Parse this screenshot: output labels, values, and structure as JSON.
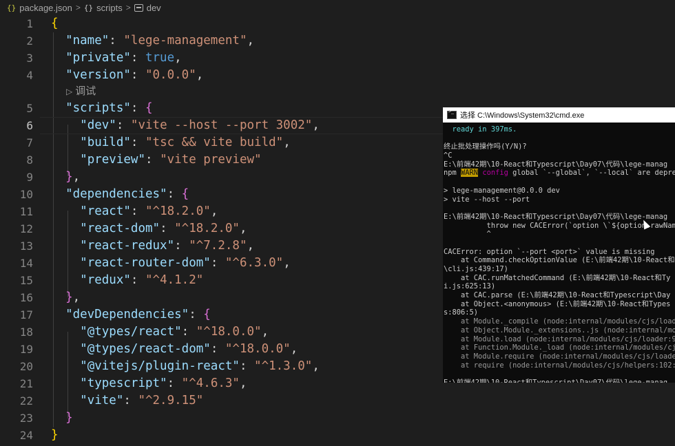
{
  "breadcrumb": {
    "file": "package.json",
    "section": "scripts",
    "key": "dev"
  },
  "codelens_label": "调试",
  "lines": [
    {
      "n": "1",
      "code": [
        [
          "b1",
          "{"
        ]
      ]
    },
    {
      "n": "2",
      "code": [
        [
          "p",
          "  "
        ],
        [
          "k",
          "\"name\""
        ],
        [
          "p",
          ": "
        ],
        [
          "s",
          "\"lege-management\""
        ],
        [
          "p",
          ","
        ]
      ]
    },
    {
      "n": "3",
      "code": [
        [
          "p",
          "  "
        ],
        [
          "k",
          "\"private\""
        ],
        [
          "p",
          ": "
        ],
        [
          "t",
          "true"
        ],
        [
          "p",
          ","
        ]
      ]
    },
    {
      "n": "4",
      "code": [
        [
          "p",
          "  "
        ],
        [
          "k",
          "\"version\""
        ],
        [
          "p",
          ": "
        ],
        [
          "s",
          "\"0.0.0\""
        ],
        [
          "p",
          ","
        ]
      ]
    },
    {
      "n": "5",
      "code": [
        [
          "p",
          "  "
        ],
        [
          "k",
          "\"scripts\""
        ],
        [
          "p",
          ": "
        ],
        [
          "b2",
          "{"
        ]
      ]
    },
    {
      "n": "6",
      "code": [
        [
          "p",
          "    "
        ],
        [
          "k",
          "\"dev\""
        ],
        [
          "p",
          ": "
        ],
        [
          "s",
          "\"vite --host --port 3002\""
        ],
        [
          "p",
          ","
        ]
      ]
    },
    {
      "n": "7",
      "code": [
        [
          "p",
          "    "
        ],
        [
          "k",
          "\"build\""
        ],
        [
          "p",
          ": "
        ],
        [
          "s",
          "\"tsc && vite build\""
        ],
        [
          "p",
          ","
        ]
      ]
    },
    {
      "n": "8",
      "code": [
        [
          "p",
          "    "
        ],
        [
          "k",
          "\"preview\""
        ],
        [
          "p",
          ": "
        ],
        [
          "s",
          "\"vite preview\""
        ]
      ]
    },
    {
      "n": "9",
      "code": [
        [
          "p",
          "  "
        ],
        [
          "b2",
          "}"
        ],
        [
          "p",
          ","
        ]
      ]
    },
    {
      "n": "10",
      "code": [
        [
          "p",
          "  "
        ],
        [
          "k",
          "\"dependencies\""
        ],
        [
          "p",
          ": "
        ],
        [
          "b2",
          "{"
        ]
      ]
    },
    {
      "n": "11",
      "code": [
        [
          "p",
          "    "
        ],
        [
          "k",
          "\"react\""
        ],
        [
          "p",
          ": "
        ],
        [
          "s",
          "\"^18.2.0\""
        ],
        [
          "p",
          ","
        ]
      ]
    },
    {
      "n": "12",
      "code": [
        [
          "p",
          "    "
        ],
        [
          "k",
          "\"react-dom\""
        ],
        [
          "p",
          ": "
        ],
        [
          "s",
          "\"^18.2.0\""
        ],
        [
          "p",
          ","
        ]
      ]
    },
    {
      "n": "13",
      "code": [
        [
          "p",
          "    "
        ],
        [
          "k",
          "\"react-redux\""
        ],
        [
          "p",
          ": "
        ],
        [
          "s",
          "\"^7.2.8\""
        ],
        [
          "p",
          ","
        ]
      ]
    },
    {
      "n": "14",
      "code": [
        [
          "p",
          "    "
        ],
        [
          "k",
          "\"react-router-dom\""
        ],
        [
          "p",
          ": "
        ],
        [
          "s",
          "\"^6.3.0\""
        ],
        [
          "p",
          ","
        ]
      ]
    },
    {
      "n": "15",
      "code": [
        [
          "p",
          "    "
        ],
        [
          "k",
          "\"redux\""
        ],
        [
          "p",
          ": "
        ],
        [
          "s",
          "\"^4.1.2\""
        ]
      ]
    },
    {
      "n": "16",
      "code": [
        [
          "p",
          "  "
        ],
        [
          "b2",
          "}"
        ],
        [
          "p",
          ","
        ]
      ]
    },
    {
      "n": "17",
      "code": [
        [
          "p",
          "  "
        ],
        [
          "k",
          "\"devDependencies\""
        ],
        [
          "p",
          ": "
        ],
        [
          "b2",
          "{"
        ]
      ]
    },
    {
      "n": "18",
      "code": [
        [
          "p",
          "    "
        ],
        [
          "k",
          "\"@types/react\""
        ],
        [
          "p",
          ": "
        ],
        [
          "s",
          "\"^18.0.0\""
        ],
        [
          "p",
          ","
        ]
      ]
    },
    {
      "n": "19",
      "code": [
        [
          "p",
          "    "
        ],
        [
          "k",
          "\"@types/react-dom\""
        ],
        [
          "p",
          ": "
        ],
        [
          "s",
          "\"^18.0.0\""
        ],
        [
          "p",
          ","
        ]
      ]
    },
    {
      "n": "20",
      "code": [
        [
          "p",
          "    "
        ],
        [
          "k",
          "\"@vitejs/plugin-react\""
        ],
        [
          "p",
          ": "
        ],
        [
          "s",
          "\"^1.3.0\""
        ],
        [
          "p",
          ","
        ]
      ]
    },
    {
      "n": "21",
      "code": [
        [
          "p",
          "    "
        ],
        [
          "k",
          "\"typescript\""
        ],
        [
          "p",
          ": "
        ],
        [
          "s",
          "\"^4.6.3\""
        ],
        [
          "p",
          ","
        ]
      ]
    },
    {
      "n": "22",
      "code": [
        [
          "p",
          "    "
        ],
        [
          "k",
          "\"vite\""
        ],
        [
          "p",
          ": "
        ],
        [
          "s",
          "\"^2.9.15\""
        ]
      ]
    },
    {
      "n": "23",
      "code": [
        [
          "p",
          "  "
        ],
        [
          "b2",
          "}"
        ]
      ]
    },
    {
      "n": "24",
      "code": [
        [
          "b1",
          "}"
        ]
      ]
    }
  ],
  "cmd": {
    "title": "选择 C:\\Windows\\System32\\cmd.exe",
    "lines": [
      {
        "c": "cyan",
        "parts": [
          [
            "",
            "  ready in 397ms."
          ]
        ]
      },
      {
        "c": "",
        "parts": [
          [
            "",
            ""
          ]
        ]
      },
      {
        "c": "",
        "parts": [
          [
            "",
            "终止批处理操作吗(Y/N)?"
          ]
        ]
      },
      {
        "c": "",
        "parts": [
          [
            "",
            "^C"
          ]
        ]
      },
      {
        "c": "",
        "parts": [
          [
            "",
            "E:\\前端42期\\10-React和Typescript\\Day07\\代码\\lege-manag"
          ]
        ]
      },
      {
        "c": "",
        "parts": [
          [
            "",
            "npm "
          ],
          [
            "warn",
            "WARN"
          ],
          [
            "mag",
            " config"
          ],
          [
            "",
            " global `--global`, `--local` are depre"
          ]
        ]
      },
      {
        "c": "",
        "parts": [
          [
            "",
            ""
          ]
        ]
      },
      {
        "c": "",
        "parts": [
          [
            "",
            "> lege-management@0.0.0 dev"
          ]
        ]
      },
      {
        "c": "",
        "parts": [
          [
            "",
            "> vite --host --port"
          ]
        ]
      },
      {
        "c": "",
        "parts": [
          [
            "",
            ""
          ]
        ]
      },
      {
        "c": "",
        "parts": [
          [
            "",
            "E:\\前端42期\\10-React和Typescript\\Day07\\代码\\lege-manag"
          ]
        ]
      },
      {
        "c": "",
        "parts": [
          [
            "",
            "          throw new CACError(`option \\`${option.rawNam"
          ]
        ]
      },
      {
        "c": "",
        "parts": [
          [
            "",
            "          ^"
          ]
        ]
      },
      {
        "c": "",
        "parts": [
          [
            "",
            ""
          ]
        ]
      },
      {
        "c": "",
        "parts": [
          [
            "",
            "CACError: option `--port <port>` value is missing"
          ]
        ]
      },
      {
        "c": "",
        "parts": [
          [
            "",
            "    at Command.checkOptionValue (E:\\前端42期\\10-React和"
          ]
        ]
      },
      {
        "c": "",
        "parts": [
          [
            "",
            "\\cli.js:439:17)"
          ]
        ]
      },
      {
        "c": "",
        "parts": [
          [
            "",
            "    at CAC.runMatchedCommand (E:\\前端42期\\10-React和Ty"
          ]
        ]
      },
      {
        "c": "",
        "parts": [
          [
            "",
            "i.js:625:13)"
          ]
        ]
      },
      {
        "c": "",
        "parts": [
          [
            "",
            "    at CAC.parse (E:\\前端42期\\10-React和Typescript\\Day"
          ]
        ]
      },
      {
        "c": "",
        "parts": [
          [
            "",
            "    at Object.<anonymous> (E:\\前端42期\\10-React和Types"
          ]
        ]
      },
      {
        "c": "",
        "parts": [
          [
            "",
            "s:806:5)"
          ]
        ]
      },
      {
        "c": "dim",
        "parts": [
          [
            "",
            "    at Module._compile (node:internal/modules/cjs/load"
          ]
        ]
      },
      {
        "c": "dim",
        "parts": [
          [
            "",
            "    at Object.Module._extensions..js (node:internal/mo"
          ]
        ]
      },
      {
        "c": "dim",
        "parts": [
          [
            "",
            "    at Module.load (node:internal/modules/cjs/loader:9"
          ]
        ]
      },
      {
        "c": "dim",
        "parts": [
          [
            "",
            "    at Function.Module._load (node:internal/modules/cj"
          ]
        ]
      },
      {
        "c": "dim",
        "parts": [
          [
            "",
            "    at Module.require (node:internal/modules/cjs/loade"
          ]
        ]
      },
      {
        "c": "dim",
        "parts": [
          [
            "",
            "    at require (node:internal/modules/cjs/helpers:102:"
          ]
        ]
      },
      {
        "c": "",
        "parts": [
          [
            "",
            ""
          ]
        ]
      },
      {
        "c": "",
        "parts": [
          [
            "",
            "E:\\前端42期\\10-React和Typescript\\Day07\\代码\\lege-manag"
          ]
        ]
      }
    ]
  }
}
